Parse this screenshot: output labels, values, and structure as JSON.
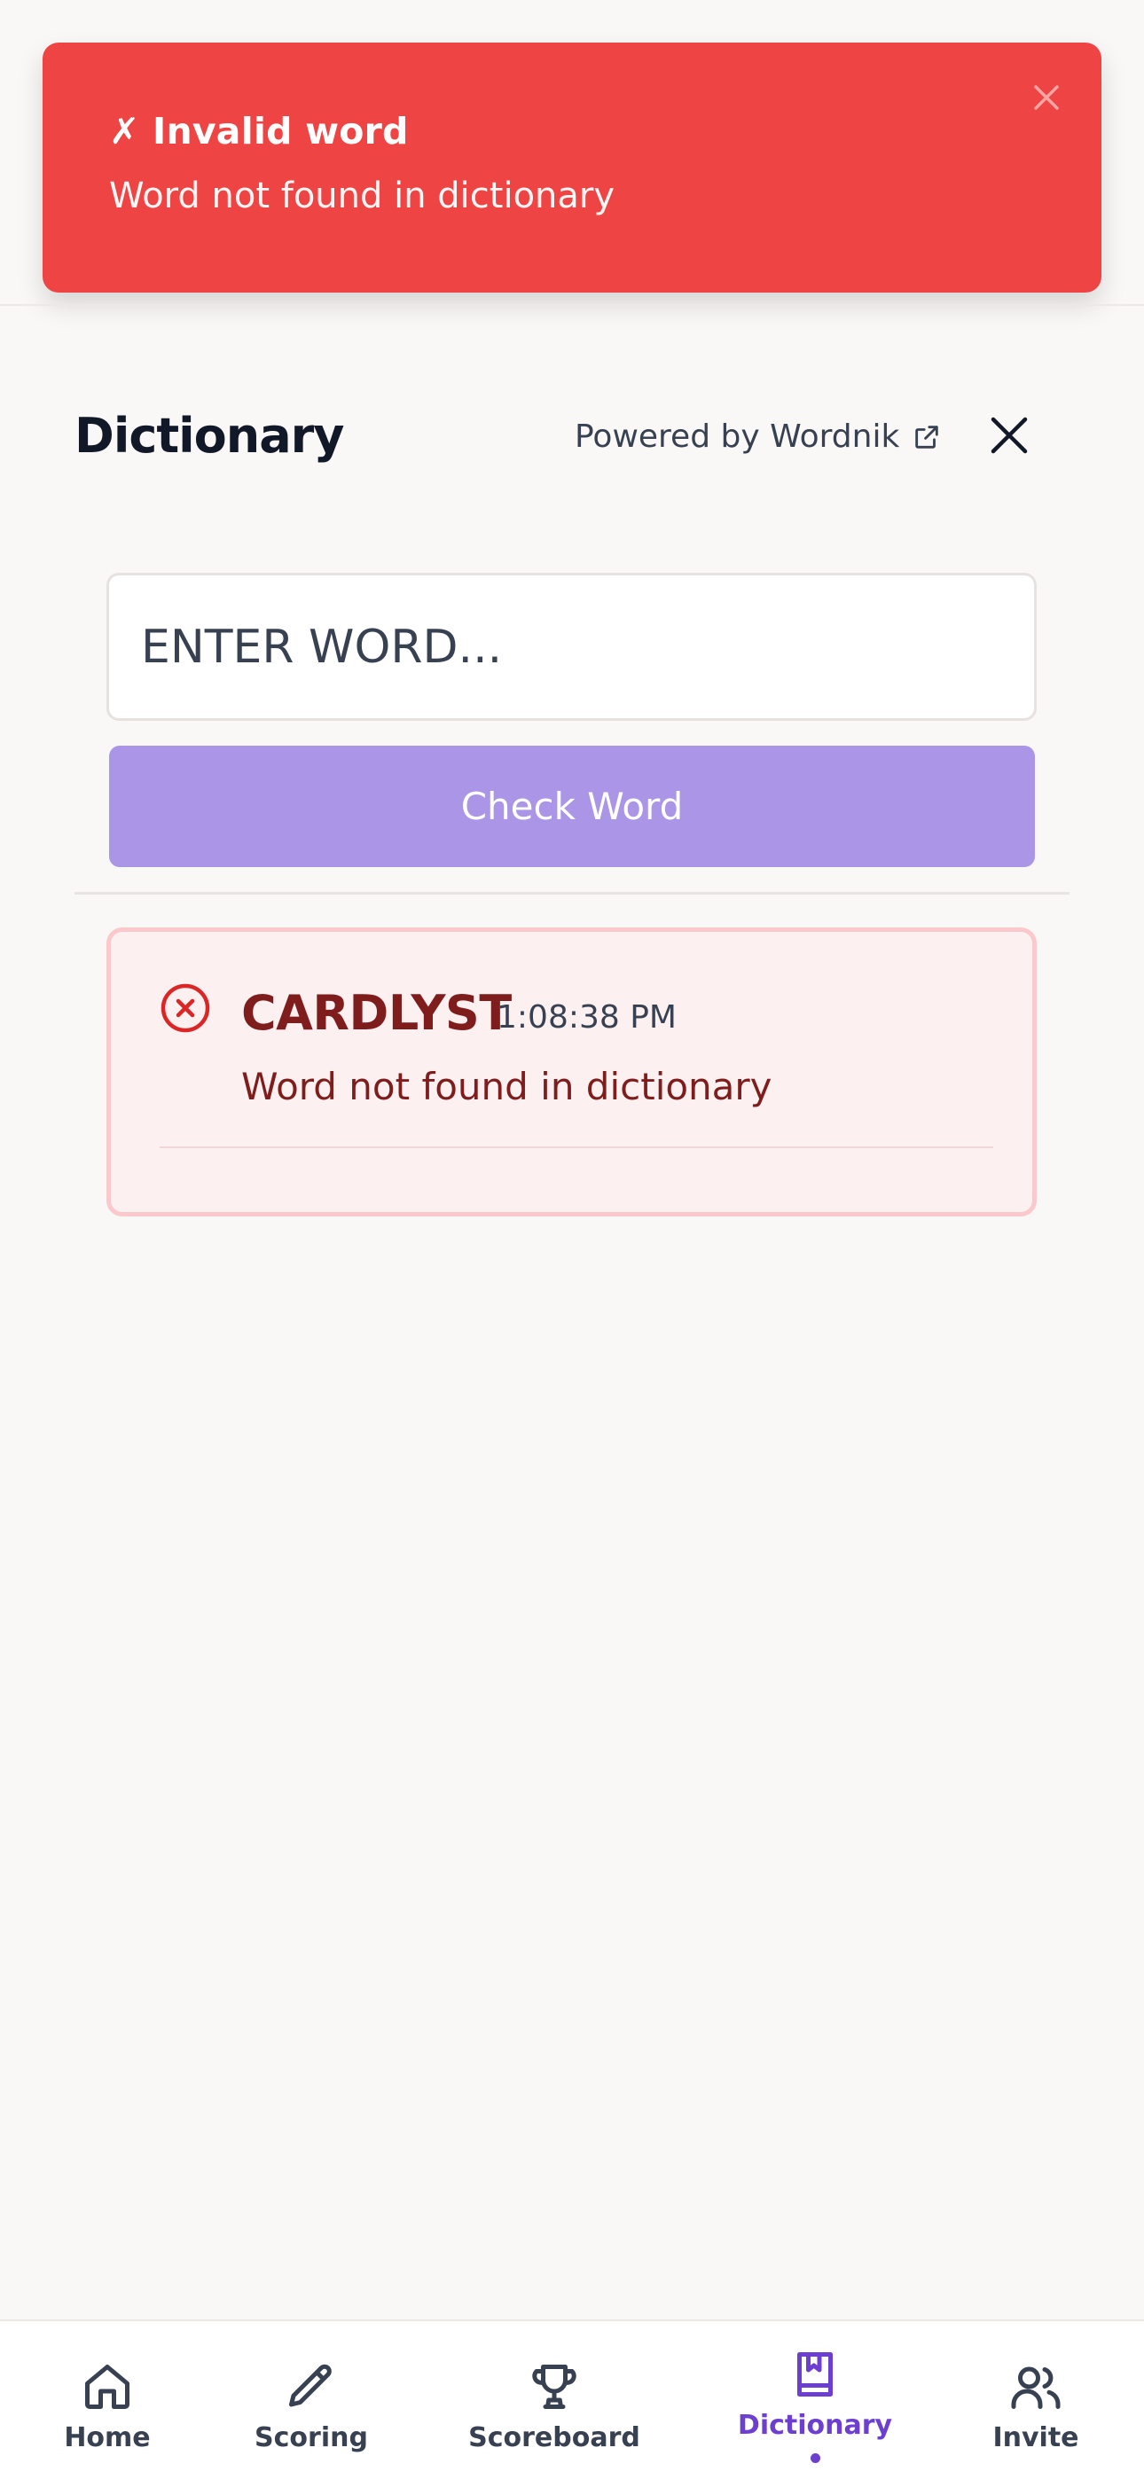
{
  "toast": {
    "title": "✗ Invalid word",
    "message": "Word not found in dictionary"
  },
  "header": {
    "title": "Dictionary",
    "powered_by": "Powered by Wordnik"
  },
  "search": {
    "placeholder": "ENTER WORD...",
    "value": "",
    "button_label": "Check Word"
  },
  "results": [
    {
      "word": "CARDLYST",
      "time": "1:08:38 PM",
      "message": "Word not found in dictionary",
      "status": "invalid"
    }
  ],
  "nav": {
    "items": [
      {
        "label": "Home",
        "icon": "home-icon",
        "active": false
      },
      {
        "label": "Scoring",
        "icon": "pencil-icon",
        "active": false
      },
      {
        "label": "Scoreboard",
        "icon": "trophy-icon",
        "active": false
      },
      {
        "label": "Dictionary",
        "icon": "book-icon",
        "active": true
      },
      {
        "label": "Invite",
        "icon": "users-icon",
        "active": false
      }
    ]
  },
  "colors": {
    "toast_bg": "#ef4444",
    "accent": "#6d3fd0",
    "button_bg": "#ab95e6",
    "error_text": "#7f1d1d",
    "error_card_bg": "#fdf0f1",
    "error_card_border": "#fbc8cc",
    "page_bg": "#faf8f7"
  }
}
